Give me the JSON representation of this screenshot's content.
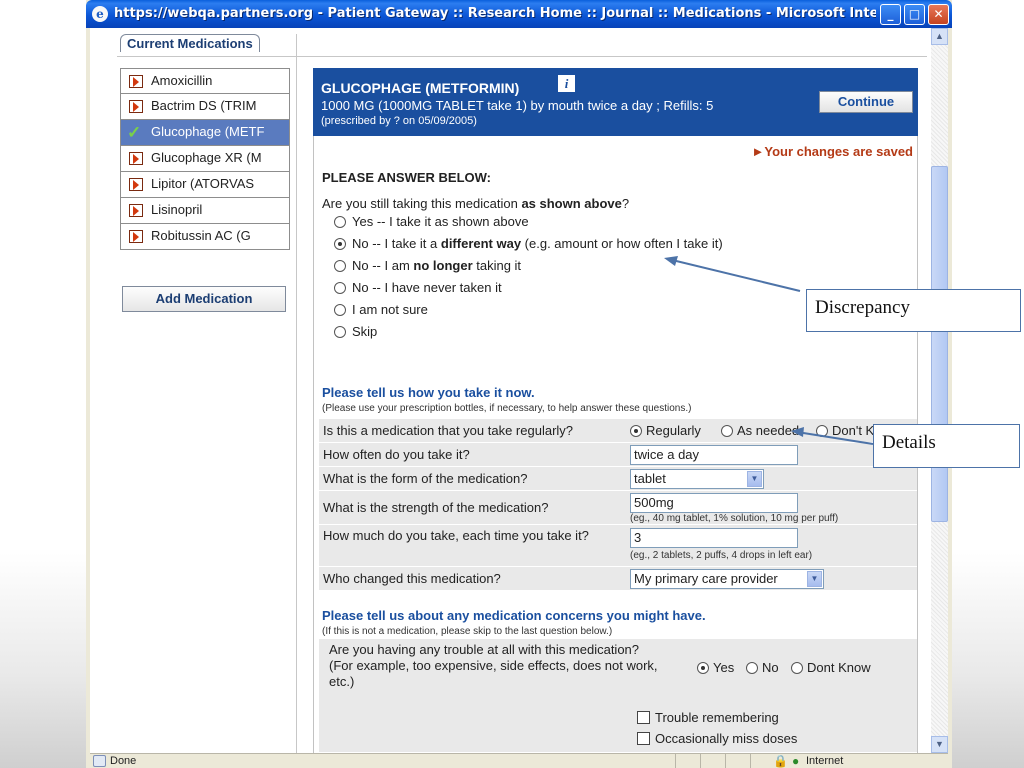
{
  "window": {
    "title": "https://webqa.partners.org - Patient Gateway :: Research Home :: Journal :: Medications - Microsoft Internet Ex...",
    "min_label": "_",
    "max_label": "□",
    "close_label": "✕"
  },
  "status": {
    "left": "Done",
    "zone": "Internet"
  },
  "section_tab": "Current Medications",
  "medications": [
    {
      "label": "Amoxicillin",
      "state": "pending"
    },
    {
      "label": "Bactrim DS (TRIM",
      "state": "pending"
    },
    {
      "label": "Glucophage (METF",
      "state": "selected"
    },
    {
      "label": "Glucophage XR (M",
      "state": "pending"
    },
    {
      "label": "Lipitor (ATORVAS",
      "state": "pending"
    },
    {
      "label": "Lisinopril",
      "state": "pending"
    },
    {
      "label": "Robitussin AC (G",
      "state": "pending"
    }
  ],
  "add_medication": "Add Medication",
  "detail": {
    "name": "GLUCOPHAGE (METFORMIN)",
    "info_icon": "i",
    "dose": "1000 MG (1000MG TABLET take 1) by mouth twice a day ; Refills: 5",
    "prescribed": "(prescribed by ? on 05/09/2005)",
    "continue_label": "Continue",
    "saved_notice": "►Your changes are saved",
    "answer_heading": "PLEASE ANSWER BELOW:",
    "question_pre": "Are you still taking this medication ",
    "question_bold": "as shown above",
    "question_post": "?",
    "options": [
      {
        "pre": "Yes -- I take it as shown above",
        "bold": "",
        "post": "",
        "checked": false
      },
      {
        "pre": "No -- I take it a ",
        "bold": "different way",
        "post": " (e.g. amount or how often I take it)",
        "checked": true
      },
      {
        "pre": "No -- I am ",
        "bold": "no longer",
        "post": " taking it",
        "checked": false
      },
      {
        "pre": "No -- I have never taken it",
        "bold": "",
        "post": "",
        "checked": false
      },
      {
        "pre": "I am not sure",
        "bold": "",
        "post": "",
        "checked": false
      },
      {
        "pre": "Skip",
        "bold": "",
        "post": "",
        "checked": false
      }
    ],
    "how_heading": "Please tell us how you take it now.",
    "how_sub": "(Please use your prescription bottles, if necessary, to help answer these questions.)",
    "q_regular": "Is this a medication that you take regularly?",
    "regular_options": [
      "Regularly",
      "As needed",
      "Don't Know"
    ],
    "regular_selected": "Regularly",
    "q_often": "How often do you take it?",
    "often_value": "twice a day",
    "q_form": "What is the form of the medication?",
    "form_value": "tablet",
    "q_strength": "What is the strength of the medication?",
    "strength_value": "500mg",
    "strength_hint": "(eg., 40 mg tablet, 1% solution, 10 mg per puff)",
    "q_amount": "How much do you take, each time you take it?",
    "amount_value": "3",
    "amount_hint": "(eg., 2 tablets, 2 puffs, 4 drops in left ear)",
    "q_changed": "Who changed this medication?",
    "changed_value": "My primary care provider",
    "concern_heading": "Please tell us about any medication concerns you might have.",
    "concern_sub": "(If this is not a medication, please skip to the last question below.)",
    "q_trouble": "Are you having any trouble at all with this medication? (For example, too expensive, side effects, does not work, etc.)",
    "trouble_options": [
      "Yes",
      "No",
      "Dont Know"
    ],
    "trouble_selected": "Yes",
    "checkboxes": [
      "Trouble remembering",
      "Occasionally miss doses"
    ]
  },
  "annotations": {
    "discrepancy": "Discrepancy",
    "details": "Details"
  },
  "colors": {
    "title_blue": "#0b56d6",
    "header_blue": "#1a4f9f",
    "saved_red": "#b43a16",
    "selected_row": "#5a7bbf",
    "check_green": "#7ad04a"
  }
}
